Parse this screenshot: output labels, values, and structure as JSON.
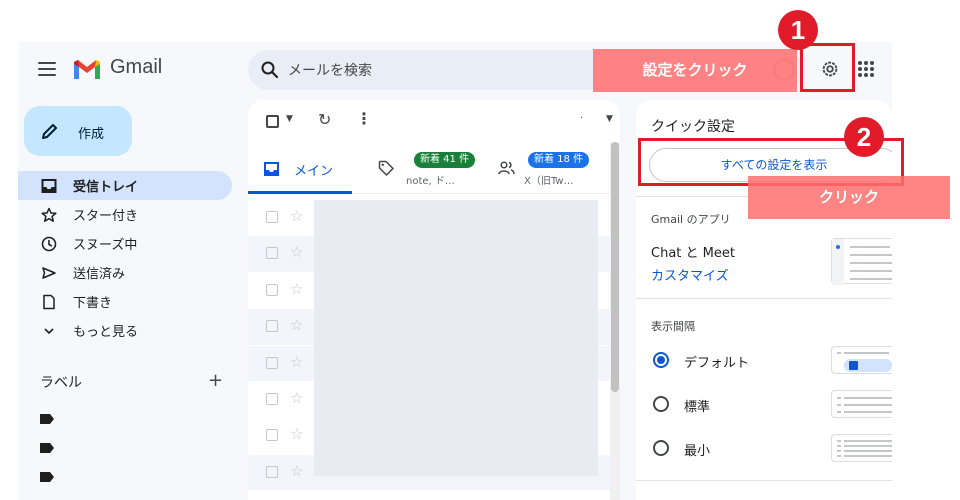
{
  "app": {
    "name": "Gmail"
  },
  "search": {
    "placeholder": "メールを検索"
  },
  "sidebar": {
    "compose_label": "作成",
    "items": [
      {
        "label": "受信トレイ",
        "icon": "inbox-icon",
        "active": true
      },
      {
        "label": "スター付き",
        "icon": "star-icon"
      },
      {
        "label": "スヌーズ中",
        "icon": "clock-icon"
      },
      {
        "label": "送信済み",
        "icon": "send-icon"
      },
      {
        "label": "下書き",
        "icon": "draft-icon"
      },
      {
        "label": "もっと見る",
        "icon": "chevron-down-icon"
      }
    ],
    "labels_heading": "ラベル",
    "labels_add": "+"
  },
  "tabs": {
    "main": {
      "label": "メイン"
    },
    "promotions": {
      "badge": "新着 41 件",
      "preview": "note, ド…"
    },
    "social": {
      "badge": "新着 18 件",
      "preview": "X（旧Tw…"
    }
  },
  "quick_settings": {
    "title": "クイック設定",
    "all_settings_button": "すべての設定を表示",
    "apps_section": "Gmail のアプリ",
    "chat_meet": "Chat と Meet",
    "customize_link": "カスタマイズ",
    "density_section": "表示間隔",
    "density_options": [
      {
        "label": "デフォルト",
        "selected": true
      },
      {
        "label": "標準",
        "selected": false
      },
      {
        "label": "最小",
        "selected": false
      }
    ]
  },
  "annotations": {
    "callout_1": "設定をクリック",
    "callout_2": "クリック",
    "step_1": "1",
    "step_2": "2"
  },
  "colors": {
    "accent": "#0b57d0",
    "highlight_red": "#e21b2b",
    "callout_pink": "#ff6e6e",
    "active_nav": "#d3e3fd"
  }
}
